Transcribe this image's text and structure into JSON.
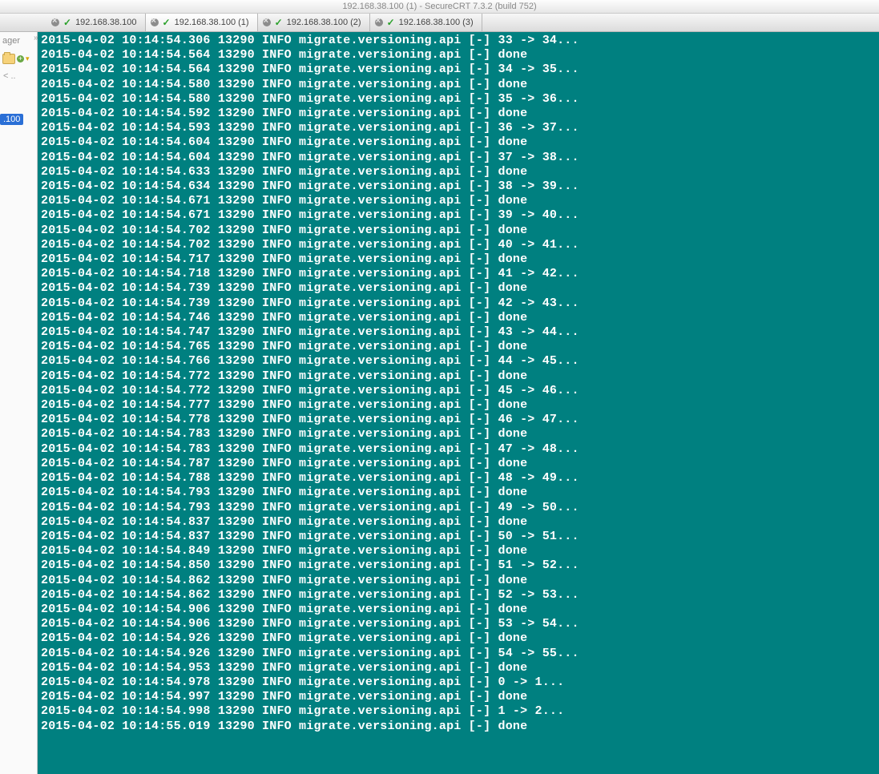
{
  "titlebar": "192.168.38.100 (1) - SecureCRT 7.3.2 (build 752)",
  "tabs": [
    {
      "label": "192.168.38.100"
    },
    {
      "label": "192.168.38.100 (1)"
    },
    {
      "label": "192.168.38.100 (2)"
    },
    {
      "label": "192.168.38.100 (3)"
    }
  ],
  "sidebar": {
    "header": "ager",
    "row2": "< ..",
    "ip": ".100"
  },
  "log": {
    "date": "2015-04-02",
    "pid": "13290",
    "level": "INFO",
    "module": "migrate.versioning.api",
    "marker": "[-]",
    "lines": [
      {
        "t": "10:14:54.306",
        "msg": "33 -> 34..."
      },
      {
        "t": "10:14:54.564",
        "msg": "done"
      },
      {
        "t": "10:14:54.564",
        "msg": "34 -> 35..."
      },
      {
        "t": "10:14:54.580",
        "msg": "done"
      },
      {
        "t": "10:14:54.580",
        "msg": "35 -> 36..."
      },
      {
        "t": "10:14:54.592",
        "msg": "done"
      },
      {
        "t": "10:14:54.593",
        "msg": "36 -> 37..."
      },
      {
        "t": "10:14:54.604",
        "msg": "done"
      },
      {
        "t": "10:14:54.604",
        "msg": "37 -> 38..."
      },
      {
        "t": "10:14:54.633",
        "msg": "done"
      },
      {
        "t": "10:14:54.634",
        "msg": "38 -> 39..."
      },
      {
        "t": "10:14:54.671",
        "msg": "done"
      },
      {
        "t": "10:14:54.671",
        "msg": "39 -> 40..."
      },
      {
        "t": "10:14:54.702",
        "msg": "done"
      },
      {
        "t": "10:14:54.702",
        "msg": "40 -> 41..."
      },
      {
        "t": "10:14:54.717",
        "msg": "done"
      },
      {
        "t": "10:14:54.718",
        "msg": "41 -> 42..."
      },
      {
        "t": "10:14:54.739",
        "msg": "done"
      },
      {
        "t": "10:14:54.739",
        "msg": "42 -> 43..."
      },
      {
        "t": "10:14:54.746",
        "msg": "done"
      },
      {
        "t": "10:14:54.747",
        "msg": "43 -> 44..."
      },
      {
        "t": "10:14:54.765",
        "msg": "done"
      },
      {
        "t": "10:14:54.766",
        "msg": "44 -> 45..."
      },
      {
        "t": "10:14:54.772",
        "msg": "done"
      },
      {
        "t": "10:14:54.772",
        "msg": "45 -> 46..."
      },
      {
        "t": "10:14:54.777",
        "msg": "done"
      },
      {
        "t": "10:14:54.778",
        "msg": "46 -> 47..."
      },
      {
        "t": "10:14:54.783",
        "msg": "done"
      },
      {
        "t": "10:14:54.783",
        "msg": "47 -> 48..."
      },
      {
        "t": "10:14:54.787",
        "msg": "done"
      },
      {
        "t": "10:14:54.788",
        "msg": "48 -> 49..."
      },
      {
        "t": "10:14:54.793",
        "msg": "done"
      },
      {
        "t": "10:14:54.793",
        "msg": "49 -> 50..."
      },
      {
        "t": "10:14:54.837",
        "msg": "done"
      },
      {
        "t": "10:14:54.837",
        "msg": "50 -> 51..."
      },
      {
        "t": "10:14:54.849",
        "msg": "done"
      },
      {
        "t": "10:14:54.850",
        "msg": "51 -> 52..."
      },
      {
        "t": "10:14:54.862",
        "msg": "done"
      },
      {
        "t": "10:14:54.862",
        "msg": "52 -> 53..."
      },
      {
        "t": "10:14:54.906",
        "msg": "done"
      },
      {
        "t": "10:14:54.906",
        "msg": "53 -> 54..."
      },
      {
        "t": "10:14:54.926",
        "msg": "done"
      },
      {
        "t": "10:14:54.926",
        "msg": "54 -> 55..."
      },
      {
        "t": "10:14:54.953",
        "msg": "done"
      },
      {
        "t": "10:14:54.978",
        "msg": "0 -> 1..."
      },
      {
        "t": "10:14:54.997",
        "msg": "done"
      },
      {
        "t": "10:14:54.998",
        "msg": "1 -> 2..."
      },
      {
        "t": "10:14:55.019",
        "msg": "done"
      }
    ]
  }
}
